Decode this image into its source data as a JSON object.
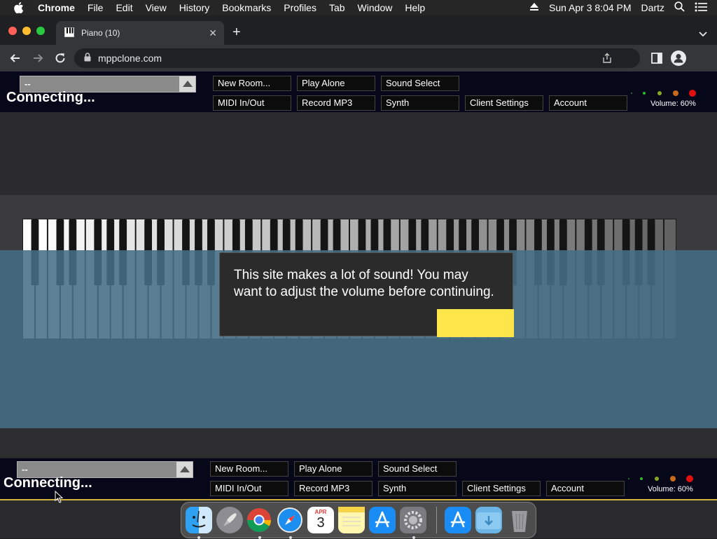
{
  "menubar": {
    "app": "Chrome",
    "items": [
      "File",
      "Edit",
      "View",
      "History",
      "Bookmarks",
      "Profiles",
      "Tab",
      "Window",
      "Help"
    ],
    "datetime": "Sun Apr 3  8:04 PM",
    "user": "Dartz"
  },
  "browser": {
    "tab_title": "Piano (10)",
    "url": "mppclone.com"
  },
  "app": {
    "top": {
      "room_select": "--",
      "status": "Connecting...",
      "buttons": [
        "New Room...",
        "Play Alone",
        "Sound Select",
        "MIDI In/Out",
        "Record MP3",
        "Synth",
        "Client Settings",
        "Account"
      ],
      "volume": "Volume: 60%"
    },
    "bottom": {
      "room_select": "--",
      "status": "Connecting...",
      "buttons": [
        "New Room...",
        "Play Alone",
        "Sound Select",
        "MIDI In/Out",
        "Record MP3",
        "Synth",
        "Client Settings",
        "Account"
      ],
      "volume": "Volume: 60%"
    },
    "notice": {
      "text": "This site makes a lot of sound! You may want to adjust the volume before continuing."
    }
  },
  "dock": {
    "calendar_month": "APR",
    "calendar_day": "3"
  },
  "colors": {
    "ok_button": "#fee64a",
    "overlay": "#466e87",
    "gold_line": "#d4b23e"
  }
}
